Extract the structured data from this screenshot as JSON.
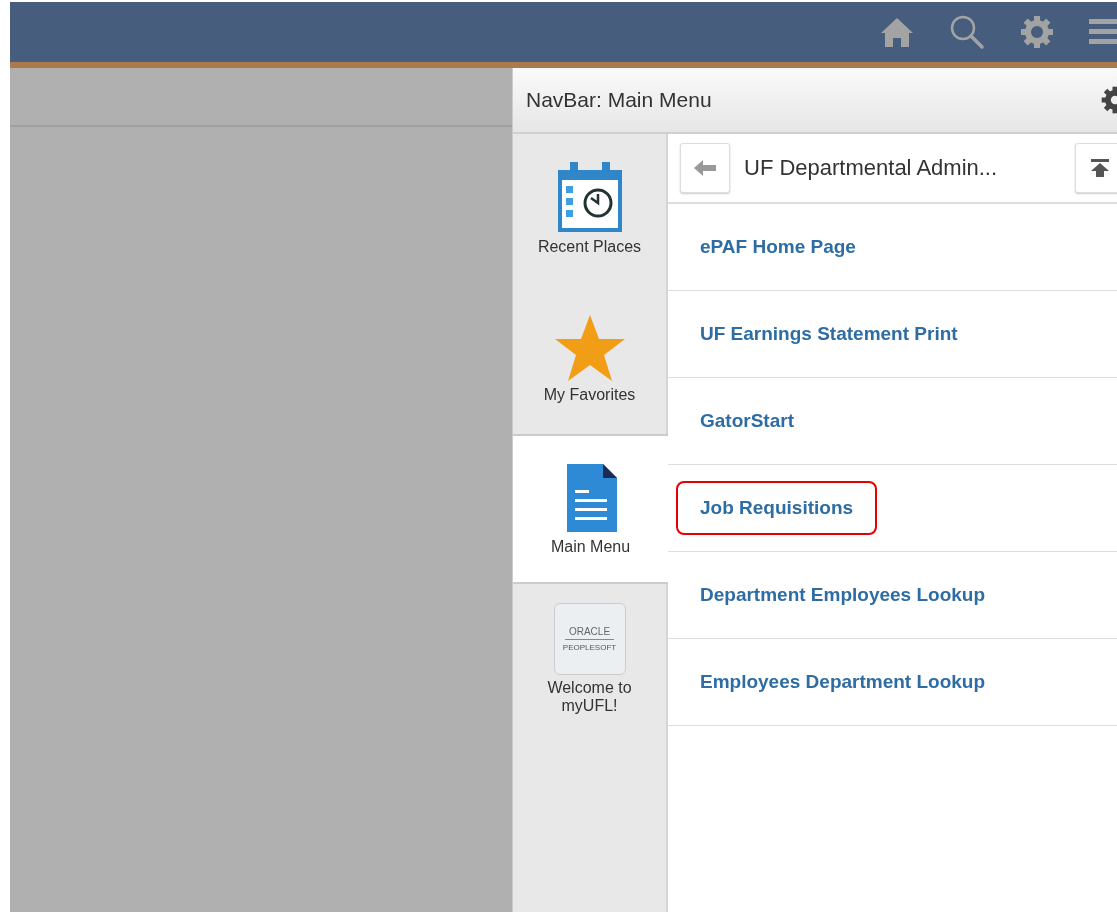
{
  "navbar": {
    "title": "NavBar: Main Menu"
  },
  "tiles": [
    {
      "kind": "calendar",
      "label": "Recent Places",
      "selected": false
    },
    {
      "kind": "star",
      "label": "My Favorites",
      "selected": false
    },
    {
      "kind": "document",
      "label": "Main Menu",
      "selected": true
    },
    {
      "kind": "logo",
      "label": "Welcome to myUFL!",
      "selected": false,
      "logo_lines": [
        "ORACLE",
        "PEOPLESOFT"
      ]
    }
  ],
  "folder": {
    "title": "UF Departmental Admin..."
  },
  "menu_items": [
    {
      "label": "ePAF Home Page",
      "highlighted": false
    },
    {
      "label": "UF Earnings Statement Print",
      "highlighted": false
    },
    {
      "label": "GatorStart",
      "highlighted": false
    },
    {
      "label": "Job Requisitions",
      "highlighted": true
    },
    {
      "label": "Department Employees Lookup",
      "highlighted": false
    },
    {
      "label": "Employees Department Lookup",
      "highlighted": false
    }
  ]
}
